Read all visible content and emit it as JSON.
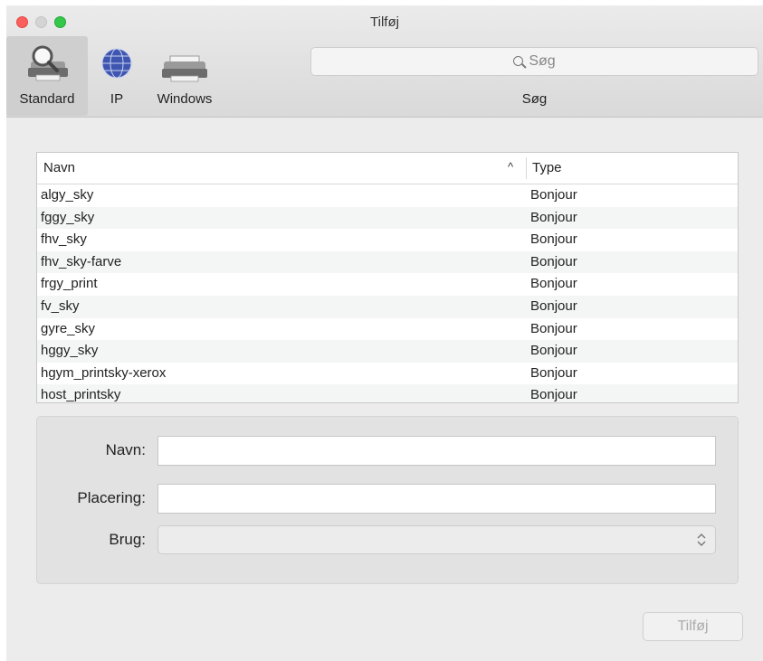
{
  "window": {
    "title": "Tilføj"
  },
  "toolbar": {
    "items": [
      {
        "label": "Standard",
        "icon": "printer-magnifier-icon",
        "selected": true
      },
      {
        "label": "IP",
        "icon": "globe-icon",
        "selected": false
      },
      {
        "label": "Windows",
        "icon": "printer-icon",
        "selected": false
      }
    ],
    "search": {
      "placeholder": "Søg",
      "label": "Søg",
      "icon": "search-icon"
    }
  },
  "printer_list": {
    "columns": {
      "name": "Navn",
      "type": "Type",
      "sort_icon": "chevron-up-icon"
    },
    "rows": [
      {
        "name": "algy_sky",
        "type": "Bonjour"
      },
      {
        "name": "fggy_sky",
        "type": "Bonjour"
      },
      {
        "name": "fhv_sky",
        "type": "Bonjour"
      },
      {
        "name": "fhv_sky-farve",
        "type": "Bonjour"
      },
      {
        "name": "frgy_print",
        "type": "Bonjour"
      },
      {
        "name": "fv_sky",
        "type": "Bonjour"
      },
      {
        "name": "gyre_sky",
        "type": "Bonjour"
      },
      {
        "name": "hggy_sky",
        "type": "Bonjour"
      },
      {
        "name": "hgym_printsky-xerox",
        "type": "Bonjour"
      },
      {
        "name": "host_printsky",
        "type": "Bonjour"
      }
    ]
  },
  "form": {
    "name_label": "Navn:",
    "name_value": "",
    "location_label": "Placering:",
    "location_value": "",
    "use_label": "Brug:",
    "use_value": ""
  },
  "actions": {
    "add_label": "Tilføj"
  },
  "colors": {
    "close": "#fc605c",
    "minimize_disabled": "#d4d4d4",
    "zoom": "#34c84a"
  }
}
